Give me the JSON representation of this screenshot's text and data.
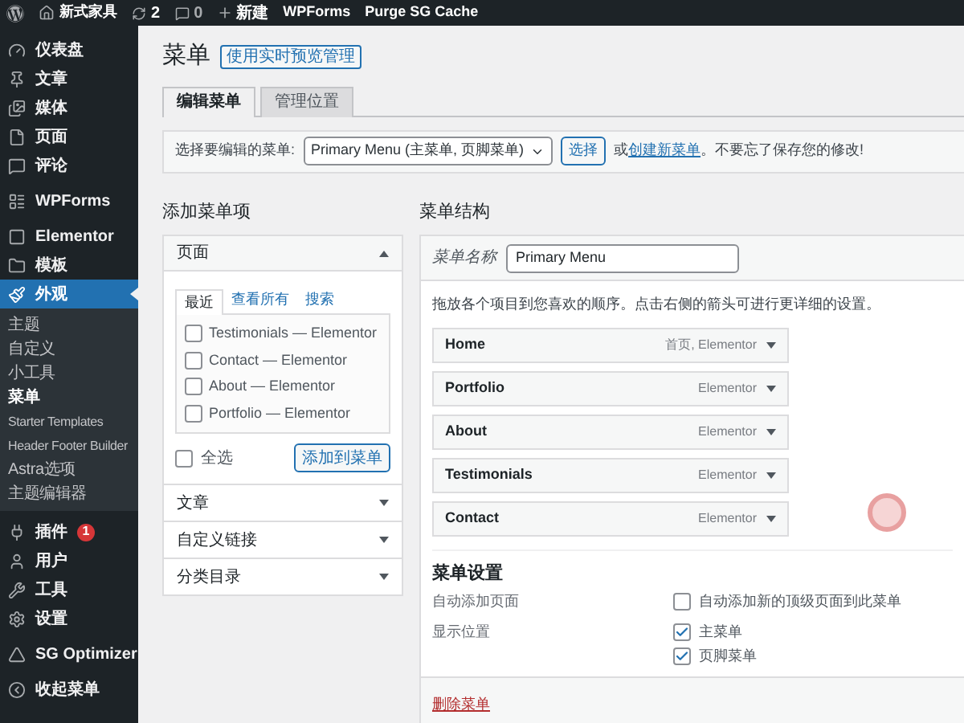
{
  "admin_bar": {
    "items": [
      {
        "kind": "logo"
      },
      {
        "kind": "site",
        "label": "新式家具"
      },
      {
        "kind": "updates",
        "label": "2"
      },
      {
        "kind": "comments",
        "label": "0"
      },
      {
        "kind": "new",
        "label": "新建"
      },
      {
        "kind": "text",
        "label": "WPForms"
      },
      {
        "kind": "text",
        "label": "Purge SG Cache"
      }
    ]
  },
  "sidebar": {
    "items": [
      {
        "label": "仪表盘",
        "selected": false
      },
      {
        "label": "文章",
        "selected": false
      },
      {
        "label": "媒体",
        "selected": false
      },
      {
        "label": "页面",
        "selected": false
      },
      {
        "label": "评论",
        "selected": false
      },
      {
        "label": "WPForms",
        "selected": false
      },
      {
        "label": "Elementor",
        "selected": false
      },
      {
        "label": "模板",
        "selected": false
      },
      {
        "label": "外观",
        "selected": true,
        "children": [
          {
            "label": "主题",
            "selected": false
          },
          {
            "label": "自定义",
            "selected": false
          },
          {
            "label": "小工具",
            "selected": false
          },
          {
            "label": "菜单",
            "selected": true
          },
          {
            "label": "Starter Templates",
            "selected": false
          },
          {
            "label": "Header Footer Builder",
            "selected": false
          },
          {
            "label": "Astra选项",
            "selected": false
          },
          {
            "label": "主题编辑器",
            "selected": false
          }
        ]
      },
      {
        "label": "插件",
        "selected": false,
        "badge": "1"
      },
      {
        "label": "用户",
        "selected": false
      },
      {
        "label": "工具",
        "selected": false
      },
      {
        "label": "设置",
        "selected": false
      },
      {
        "label": "SG Optimizer",
        "selected": false
      },
      {
        "label": "收起菜单",
        "selected": false
      }
    ]
  },
  "page": {
    "title": "菜单",
    "title_button": "使用实时预览管理",
    "tabs": [
      {
        "label": "编辑菜单",
        "selected": true
      },
      {
        "label": "管理位置",
        "selected": false
      }
    ],
    "selector": {
      "label": "选择要编辑的菜单:",
      "value": "Primary Menu (主菜单, 页脚菜单)",
      "button": "选择",
      "prefix": "或",
      "link": "创建新菜单",
      "suffix": "。不要忘了保存您的修改!"
    }
  },
  "add_items": {
    "heading": "添加菜单项",
    "sections": [
      {
        "title": "页面",
        "expanded": true,
        "tabs": [
          {
            "label": "最近",
            "selected": true
          },
          {
            "label": "查看所有",
            "selected": false
          },
          {
            "label": "搜索",
            "selected": false
          }
        ],
        "items": [
          {
            "label": "Testimonials — Elementor",
            "checked": false
          },
          {
            "label": "Contact — Elementor",
            "checked": false
          },
          {
            "label": "About — Elementor",
            "checked": false
          },
          {
            "label": "Portfolio — Elementor",
            "checked": false
          }
        ],
        "select_all": {
          "label": "全选",
          "checked": false
        },
        "button": "添加到菜单"
      },
      {
        "title": "文章",
        "expanded": false
      },
      {
        "title": "自定义链接",
        "expanded": false
      },
      {
        "title": "分类目录",
        "expanded": false
      }
    ]
  },
  "structure": {
    "heading": "菜单结构",
    "name_label": "菜单名称",
    "name_value": "Primary Menu",
    "instructions": "拖放各个项目到您喜欢的顺序。点击右侧的箭头可进行更详细的设置。",
    "items": [
      {
        "title": "Home",
        "type": "首页, Elementor"
      },
      {
        "title": "Portfolio",
        "type": "Elementor"
      },
      {
        "title": "About",
        "type": "Elementor"
      },
      {
        "title": "Testimonials",
        "type": "Elementor"
      },
      {
        "title": "Contact",
        "type": "Elementor"
      }
    ],
    "settings": {
      "heading": "菜单设置",
      "rows": [
        {
          "label": "自动添加页面",
          "options": [
            {
              "label": "自动添加新的顶级页面到此菜单",
              "checked": false
            }
          ]
        },
        {
          "label": "显示位置",
          "options": [
            {
              "label": "主菜单",
              "checked": true
            },
            {
              "label": "页脚菜单",
              "checked": true
            }
          ]
        }
      ]
    },
    "delete_link": "删除菜单"
  }
}
